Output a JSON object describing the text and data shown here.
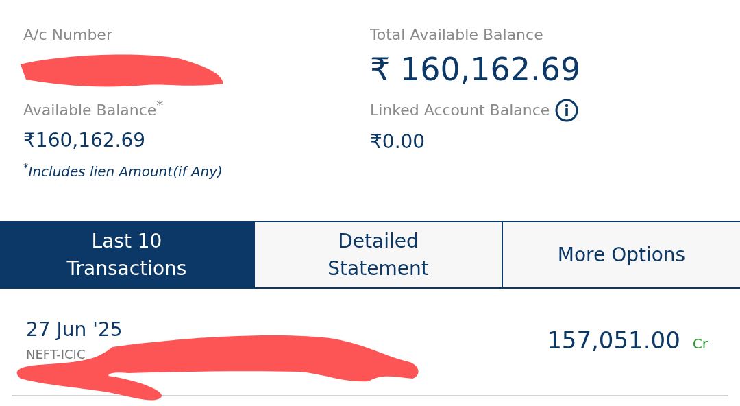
{
  "account": {
    "number_label": "A/c Number",
    "available_label": "Available Balance",
    "available_mark": "*",
    "available_value": "₹160,162.69",
    "note": "$^{*}$*Includes lien Amount(if Any)*",
    "total_label": "Total Available Balance",
    "total_value": "₹ 160,162.69",
    "linked_label": "Linked Account Balance",
    "linked_value": "₹0.00"
  },
  "tabs": [
    {
      "label": "Last 10 Transactions",
      "selected": true
    },
    {
      "label": "Detailed Statement",
      "selected": false
    },
    {
      "label": "More Options",
      "selected": false
    }
  ],
  "transactions": [
    {
      "date": "27 Jun '25",
      "description": "NEFT-ICIC",
      "amount": "157,051.00",
      "type": "Cr"
    }
  ]
}
